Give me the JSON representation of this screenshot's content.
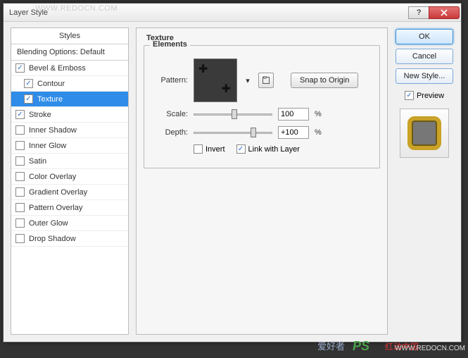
{
  "window": {
    "title": "Layer Style"
  },
  "watermarks": {
    "top": "WWW.REDOCN.COM",
    "brand_cn": "红动中国",
    "brand_url": "WWW.REDOCN.COM",
    "ps": "PS",
    "aihao": "爱好者"
  },
  "styles_panel": {
    "header": "Styles",
    "blending": "Blending Options: Default",
    "items": [
      {
        "label": "Bevel & Emboss",
        "checked": true,
        "selected": false,
        "indent": false
      },
      {
        "label": "Contour",
        "checked": true,
        "selected": false,
        "indent": true
      },
      {
        "label": "Texture",
        "checked": true,
        "selected": true,
        "indent": true
      },
      {
        "label": "Stroke",
        "checked": true,
        "selected": false,
        "indent": false
      },
      {
        "label": "Inner Shadow",
        "checked": false,
        "selected": false,
        "indent": false
      },
      {
        "label": "Inner Glow",
        "checked": false,
        "selected": false,
        "indent": false
      },
      {
        "label": "Satin",
        "checked": false,
        "selected": false,
        "indent": false
      },
      {
        "label": "Color Overlay",
        "checked": false,
        "selected": false,
        "indent": false
      },
      {
        "label": "Gradient Overlay",
        "checked": false,
        "selected": false,
        "indent": false
      },
      {
        "label": "Pattern Overlay",
        "checked": false,
        "selected": false,
        "indent": false
      },
      {
        "label": "Outer Glow",
        "checked": false,
        "selected": false,
        "indent": false
      },
      {
        "label": "Drop Shadow",
        "checked": false,
        "selected": false,
        "indent": false
      }
    ]
  },
  "texture": {
    "title": "Texture",
    "elements_title": "Elements",
    "pattern_label": "Pattern:",
    "snap_label": "Snap to Origin",
    "scale_label": "Scale:",
    "scale_value": "100",
    "scale_unit": "%",
    "scale_thumb_pct": 48,
    "depth_label": "Depth:",
    "depth_value": "+100",
    "depth_unit": "%",
    "depth_thumb_pct": 72,
    "invert_label": "Invert",
    "invert_checked": false,
    "link_label": "Link with Layer",
    "link_checked": true
  },
  "right": {
    "ok": "OK",
    "cancel": "Cancel",
    "newstyle": "New Style...",
    "preview": "Preview",
    "preview_checked": true
  }
}
